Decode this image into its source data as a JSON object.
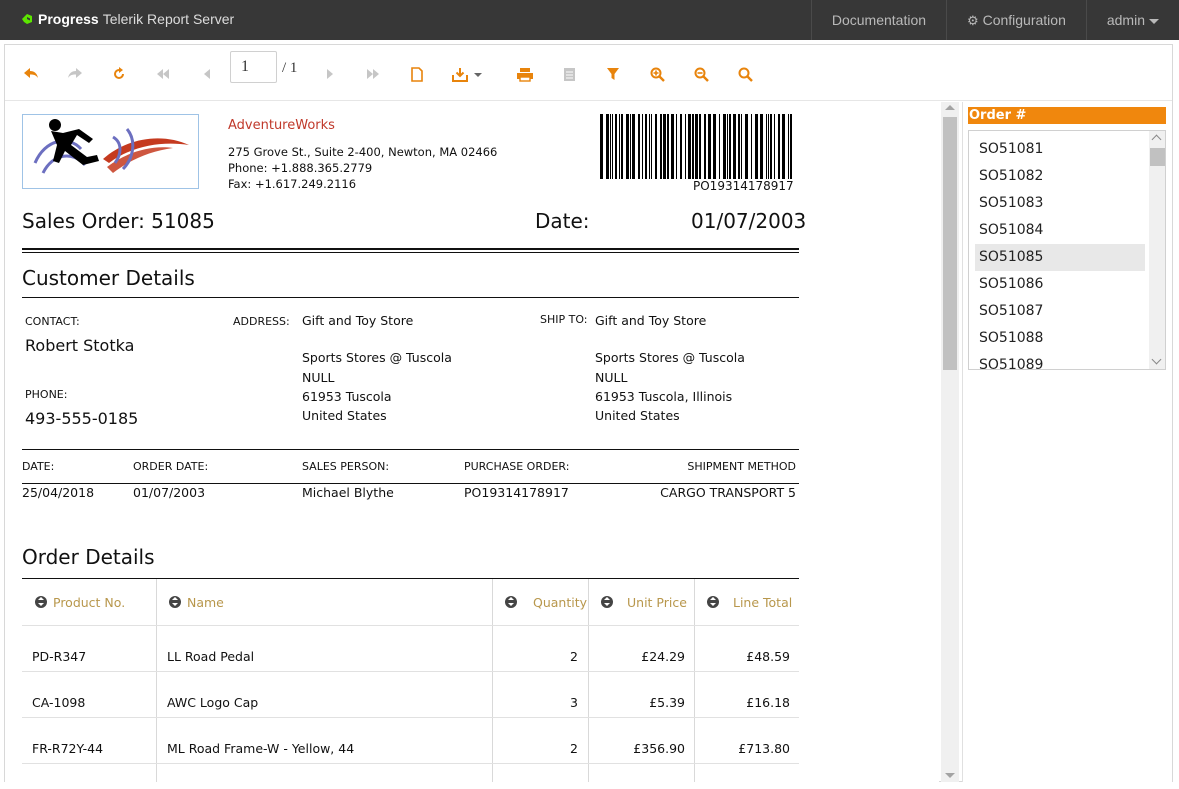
{
  "app": {
    "brand_progress": "Progress",
    "brand_product": "Telerik Report Server",
    "nav": {
      "documentation": "Documentation",
      "configuration": "Configuration",
      "user": "admin"
    }
  },
  "toolbar": {
    "page_number": "1",
    "page_total": "/ 1",
    "accent_color": "#e8840c",
    "disabled_color": "#c6c6c6",
    "icons": [
      "back-icon",
      "forward-icon",
      "refresh-icon",
      "first-page-icon",
      "previous-page-icon",
      "next-page-icon",
      "last-page-icon",
      "print-preview-icon",
      "export-icon",
      "print-icon",
      "document-map-icon",
      "filter-icon",
      "zoom-in-icon",
      "zoom-out-icon",
      "search-icon"
    ]
  },
  "report": {
    "company": {
      "name": "AdventureWorks",
      "address": "275 Grove St., Suite 2-400, Newton, MA 02466",
      "phone": "Phone: +1.888.365.2779",
      "fax": "Fax: +1.617.249.2116"
    },
    "barcode_text": "PO19314178917",
    "title": "Sales Order: 51085",
    "date_label": "Date:",
    "date_value": "01/07/2003",
    "customer_details": {
      "heading": "Customer Details",
      "contact_label": "CONTACT:",
      "contact_value": "Robert Stotka",
      "phone_label": "PHONE:",
      "phone_value": "493-555-0185",
      "address_label": "ADDRESS:",
      "address_lines": [
        "Gift and Toy Store",
        "Sports Stores @ Tuscola",
        "NULL",
        "61953 Tuscola",
        "United States"
      ],
      "shipto_label": "SHIP TO:",
      "shipto_lines": [
        "Gift and Toy Store",
        "Sports Stores @ Tuscola",
        "NULL",
        "61953 Tuscola, Illinois",
        "United States"
      ]
    },
    "info_row": {
      "date_label": "DATE:",
      "date_value": "25/04/2018",
      "order_date_label": "ORDER DATE:",
      "order_date_value": "01/07/2003",
      "sales_person_label": "SALES PERSON:",
      "sales_person_value": "Michael Blythe",
      "po_label": "PURCHASE ORDER:",
      "po_value": "PO19314178917",
      "shipment_label": "SHIPMENT METHOD",
      "shipment_value": "CARGO TRANSPORT 5"
    },
    "order_details": {
      "heading": "Order Details",
      "header_color": "#b8974c",
      "columns": [
        "Product No.",
        "Name",
        "Quantity",
        "Unit Price",
        "Line Total"
      ],
      "rows": [
        {
          "product_no": "PD-R347",
          "name": "LL Road Pedal",
          "quantity": "2",
          "unit_price": "£24.29",
          "line_total": "£48.59"
        },
        {
          "product_no": "CA-1098",
          "name": "AWC Logo Cap",
          "quantity": "3",
          "unit_price": "£5.39",
          "line_total": "£16.18"
        },
        {
          "product_no": "FR-R72Y-44",
          "name": "ML Road Frame-W - Yellow, 44",
          "quantity": "2",
          "unit_price": "£356.90",
          "line_total": "£713.80"
        }
      ]
    }
  },
  "parameters": {
    "title": "Order #",
    "title_color": "#f0870d",
    "items": [
      "SO51081",
      "SO51082",
      "SO51083",
      "SO51084",
      "SO51085",
      "SO51086",
      "SO51087",
      "SO51088",
      "SO51089"
    ],
    "selected": "SO51085"
  }
}
